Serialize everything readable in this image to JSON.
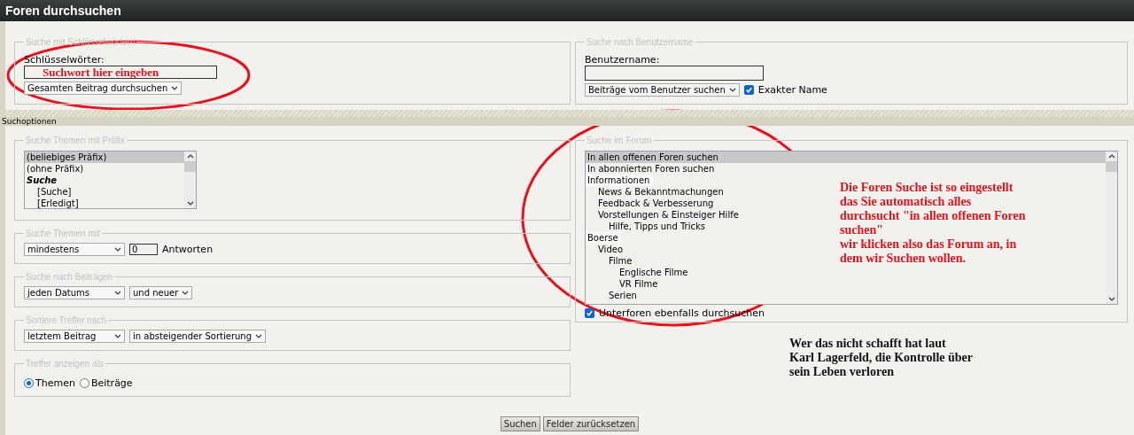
{
  "window": {
    "title": "Foren durchsuchen"
  },
  "keyword_group": {
    "legend": "Suche mit Schlüsselwörtern",
    "label": "Schlüsselwörter:",
    "field": {
      "value": "Suchwort hier eingeben"
    },
    "scope_dropdown": "Gesamten Beitrag durchsuchen"
  },
  "user_group": {
    "legend": "Suche nach Benutzername",
    "label": "Benutzername:",
    "mode_dropdown": "Beiträge vom Benutzer suchen",
    "exact_name": {
      "label": "Exakter Name",
      "checked": true
    }
  },
  "section_bar": {
    "title": "Suchoptionen"
  },
  "prefix_group": {
    "legend": "Suche Themen mit Präfix",
    "options": [
      {
        "label": "(beliebiges Präfix)",
        "kind": "option",
        "selected": true
      },
      {
        "label": "(ohne Präfix)",
        "kind": "option",
        "selected": false
      },
      {
        "label": "Suche",
        "kind": "group",
        "selected": false,
        "children": [
          {
            "label": "[Suche]",
            "selected": false
          },
          {
            "label": "[Erledigt]",
            "selected": false
          }
        ]
      }
    ]
  },
  "replies_group": {
    "legend": "Suche Themen mit",
    "dropdown": "mindestens",
    "count": "0",
    "unit": "Antworten"
  },
  "posts_group": {
    "legend": "Suche nach Beiträgen",
    "date_dropdown": "jeden Datums",
    "direction_dropdown": "und neuer"
  },
  "sort_group": {
    "legend": "Sortiere Treffer nach",
    "field_dropdown": "letztem Beitrag",
    "order_dropdown": "in absteigender Sortierung"
  },
  "display_group": {
    "legend": "Treffer anzeigen als",
    "options": [
      {
        "label": "Themen",
        "selected": true
      },
      {
        "label": "Beiträge",
        "selected": false
      }
    ]
  },
  "forum_group": {
    "legend": "Suche im Forum",
    "options": [
      {
        "label": "In allen offenen Foren suchen",
        "kind": "option",
        "selected": true
      },
      {
        "label": "In abonnierten Foren suchen",
        "kind": "option",
        "selected": false
      },
      {
        "label": "Informationen",
        "kind": "category",
        "selected": false,
        "children": [
          {
            "label": "News & Bekanntmachungen",
            "selected": false
          },
          {
            "label": "Feedback & Verbesserung",
            "selected": false
          },
          {
            "label": "Vorstellungen & Einsteiger Hilfe",
            "selected": false,
            "children": [
              {
                "label": "Hilfe, Tipps und Tricks",
                "selected": false
              }
            ]
          }
        ]
      },
      {
        "label": "Boerse",
        "kind": "category",
        "selected": false,
        "children": [
          {
            "label": "Video",
            "selected": false,
            "children": [
              {
                "label": "Filme",
                "selected": false,
                "children": [
                  {
                    "label": "Englische Filme",
                    "selected": false
                  },
                  {
                    "label": "VR Filme",
                    "selected": false
                  }
                ]
              },
              {
                "label": "Serien",
                "selected": false
              }
            ]
          }
        ]
      }
    ],
    "subforums": {
      "label": "Unterforen ebenfalls durchsuchen",
      "checked": true
    }
  },
  "annotations": [
    {
      "kind": "red",
      "text": "Die Foren Suche ist so eingestellt\ndas Sie automatisch alles\ndurchsucht \"in allen offenen Foren\nsuchen\"\nwir klicken also das Forum an, in\ndem wir Suchen wollen."
    },
    {
      "kind": "black",
      "text": "Wer das nicht schafft hat laut\nKarl Lagerfeld, die Kontrolle über\nsein Leben verloren"
    }
  ],
  "buttons": [
    {
      "label": "Suchen"
    },
    {
      "label": "Felder zurücksetzen"
    }
  ]
}
